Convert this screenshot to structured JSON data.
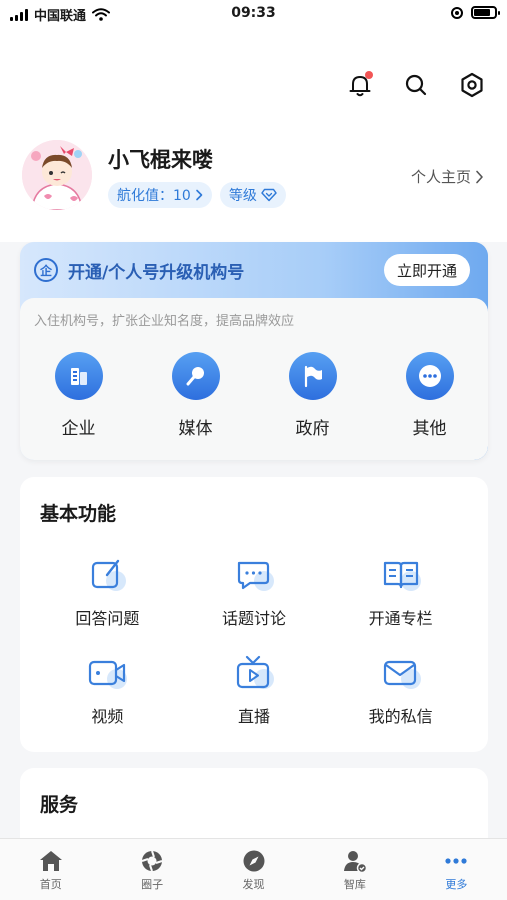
{
  "status_bar": {
    "carrier": "中国联通",
    "time": "09:33"
  },
  "user": {
    "name": "小飞棍来喽",
    "navigation_value": "航化值：10",
    "level_label": "等级",
    "homepage_link": "个人主页"
  },
  "upgrade_card": {
    "icon_char": "企",
    "title": "开通/个人号升级机构号",
    "button": "立即开通",
    "description": "入住机构号，扩张企业知名度，提高品牌效应",
    "org_types": [
      {
        "label": "企业",
        "icon": "building-icon"
      },
      {
        "label": "媒体",
        "icon": "microphone-icon"
      },
      {
        "label": "政府",
        "icon": "flag-icon"
      },
      {
        "label": "其他",
        "icon": "more-icon"
      }
    ]
  },
  "basic_functions": {
    "title": "基本功能",
    "items": [
      {
        "label": "回答问题",
        "icon": "edit-icon"
      },
      {
        "label": "话题讨论",
        "icon": "chat-icon"
      },
      {
        "label": "开通专栏",
        "icon": "book-icon"
      },
      {
        "label": "视频",
        "icon": "video-icon"
      },
      {
        "label": "直播",
        "icon": "tv-icon"
      },
      {
        "label": "我的私信",
        "icon": "mail-icon"
      }
    ]
  },
  "services": {
    "title": "服务"
  },
  "tab_bar": {
    "tabs": [
      {
        "label": "首页",
        "icon": "home-icon"
      },
      {
        "label": "圈子",
        "icon": "aperture-icon"
      },
      {
        "label": "发现",
        "icon": "compass-icon"
      },
      {
        "label": "智库",
        "icon": "user-badge-icon"
      },
      {
        "label": "更多",
        "icon": "more-dots-icon"
      }
    ],
    "active": "更多"
  },
  "colors": {
    "accent": "#2f7ad8",
    "notification_dot": "#f25555",
    "card_gradient_end": "#6ea9ef"
  }
}
